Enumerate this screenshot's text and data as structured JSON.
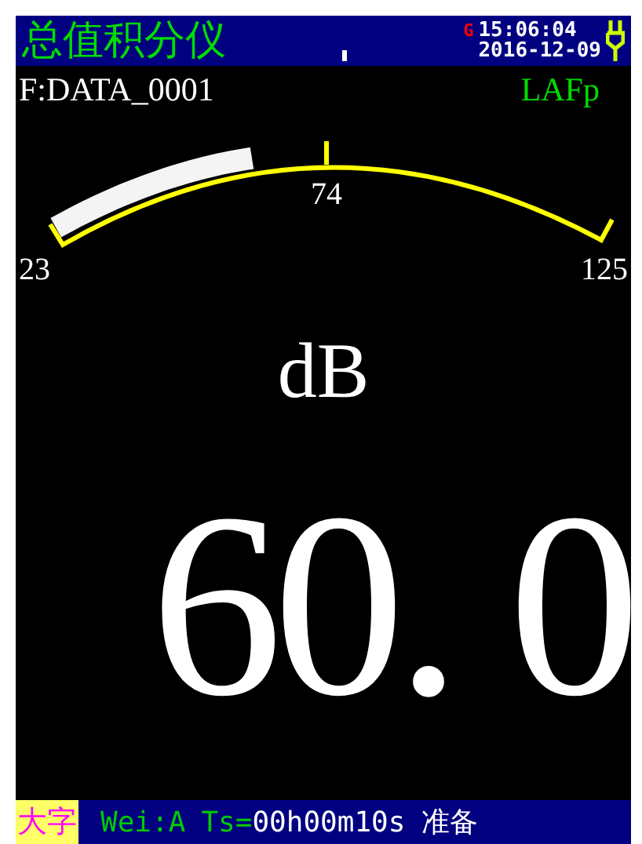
{
  "header": {
    "title": "总值积分仪",
    "gps": "G",
    "time": "15:06:04",
    "date": "2016-12-09"
  },
  "file": "F:DATA_0001",
  "mode": "LAFp",
  "gauge": {
    "min": "23",
    "mid": "74",
    "max": "125",
    "level": 0.36
  },
  "unit": "dB",
  "value": "60. 0",
  "footer": {
    "font_button": "大字",
    "weighting": "Wei:A",
    "ts_label": "Ts=",
    "ts_value": "00h00m10s",
    "status": "准备"
  }
}
